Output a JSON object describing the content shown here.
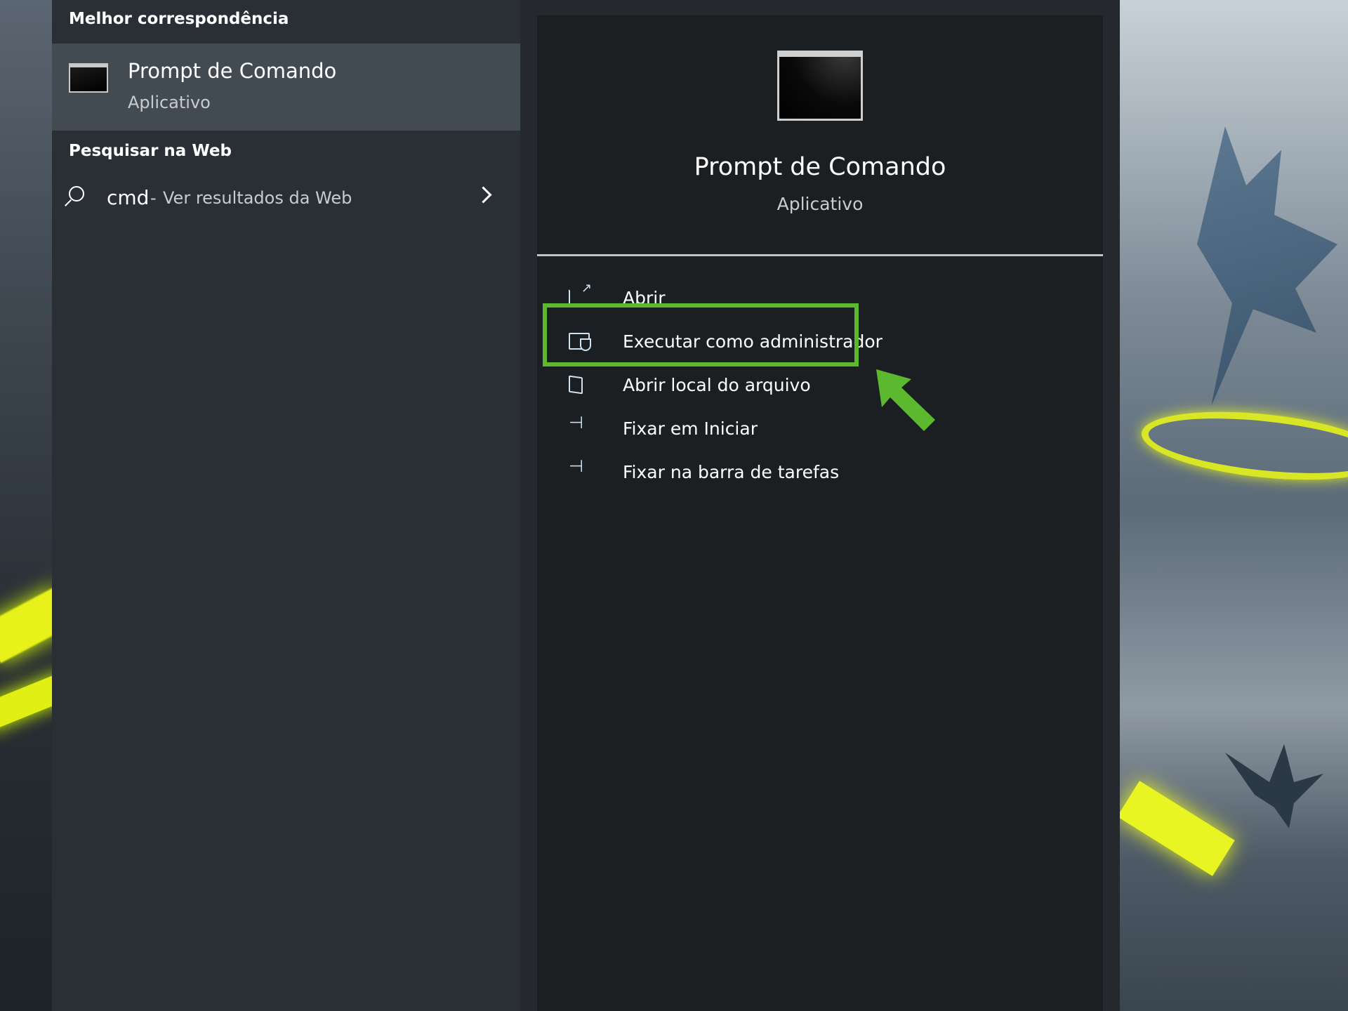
{
  "best_match": {
    "section_title": "Melhor correspondência",
    "app_name": "Prompt de Comando",
    "app_type": "Aplicativo"
  },
  "web_search": {
    "section_title": "Pesquisar na Web",
    "query": "cmd",
    "separator": "-",
    "hint": "Ver resultados da Web"
  },
  "details": {
    "title": "Prompt de Comando",
    "type": "Aplicativo",
    "actions": [
      {
        "label": "Abrir",
        "icon": "open-icon"
      },
      {
        "label": "Executar como administrador",
        "icon": "admin-shield-icon"
      },
      {
        "label": "Abrir local do arquivo",
        "icon": "file-location-icon"
      },
      {
        "label": "Fixar em Iniciar",
        "icon": "pin-icon"
      },
      {
        "label": "Fixar na barra de tarefas",
        "icon": "pin-icon"
      }
    ]
  },
  "colors": {
    "highlight": "#5cb82e",
    "pane_left": "#2a2f36",
    "pane_right": "#1c1f22",
    "best_match_bg": "#434b52"
  }
}
